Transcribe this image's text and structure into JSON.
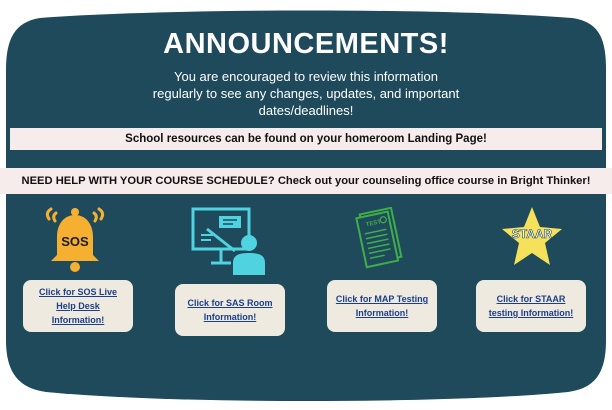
{
  "header": {
    "title": "ANNOUNCEMENTS!",
    "intro": "You are encouraged to review this information regularly to see any changes, updates, and important dates/deadlines!"
  },
  "bands": {
    "resources": "School resources can be found on your homeroom Landing Page!",
    "schedule": "NEED HELP WITH YOUR COURSE SCHEDULE?  Check out your counseling office course in Bright Thinker!"
  },
  "icons": {
    "sos": {
      "name": "bell-sos-icon",
      "text": "SOS"
    },
    "sas": {
      "name": "teacher-board-icon"
    },
    "map": {
      "name": "test-paper-icon",
      "text": "TEST"
    },
    "staar": {
      "name": "star-icon",
      "text": "STAAR"
    }
  },
  "buttons": [
    {
      "label": "Click for  SOS Live Help Desk Information!"
    },
    {
      "label": "Click for  SAS Room Information!"
    },
    {
      "label": "Click for MAP Testing Information!"
    },
    {
      "label": "Click for STAAR testing Information!"
    }
  ],
  "colors": {
    "board": "#1e4a5c",
    "band": "#f7ecec",
    "button": "#eeeadf",
    "link": "#1d3f8a",
    "bell": "#f5b031",
    "teacher": "#4fd3e0",
    "test": "#3fae49",
    "star": "#f6e25a"
  }
}
